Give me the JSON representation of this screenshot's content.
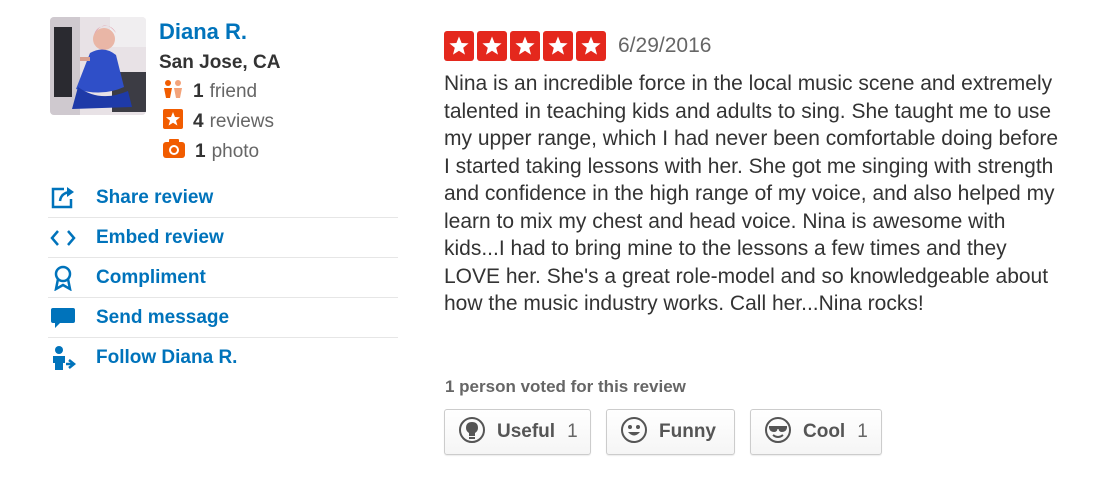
{
  "user": {
    "name": "Diana R.",
    "location": "San Jose, CA",
    "friends_count": "1",
    "friends_label": "friend",
    "reviews_count": "4",
    "reviews_label": "reviews",
    "photos_count": "1",
    "photos_label": "photo",
    "avatar_icon": "user-photo"
  },
  "actions": [
    {
      "label": "Share review",
      "icon": "share-icon"
    },
    {
      "label": "Embed review",
      "icon": "embed-icon"
    },
    {
      "label": "Compliment",
      "icon": "compliment-icon"
    },
    {
      "label": "Send message",
      "icon": "message-icon"
    },
    {
      "label": "Follow Diana R.",
      "icon": "follow-icon"
    }
  ],
  "review": {
    "rating": 5,
    "date": "6/29/2016",
    "text": "Nina is an incredible force in the local music scene and extremely talented in teaching kids and adults to sing. She taught me to use my upper range, which I had never been comfortable doing before I started taking lessons with her. She got me singing with strength and confidence in the high range of my voice, and also helped my learn to mix my chest and head voice. Nina is awesome with kids...I had to bring mine to the lessons a few times and they LOVE her. She's a great role-model and so knowledgeable about how the music industry works. Call her...Nina rocks!"
  },
  "votes": {
    "summary": "1 person voted for this review",
    "useful_label": "Useful",
    "useful_count": "1",
    "funny_label": "Funny",
    "funny_count": "",
    "cool_label": "Cool",
    "cool_count": "1"
  },
  "colors": {
    "link": "#0073bb",
    "star": "#e4281d",
    "orange": "#f15c00"
  }
}
